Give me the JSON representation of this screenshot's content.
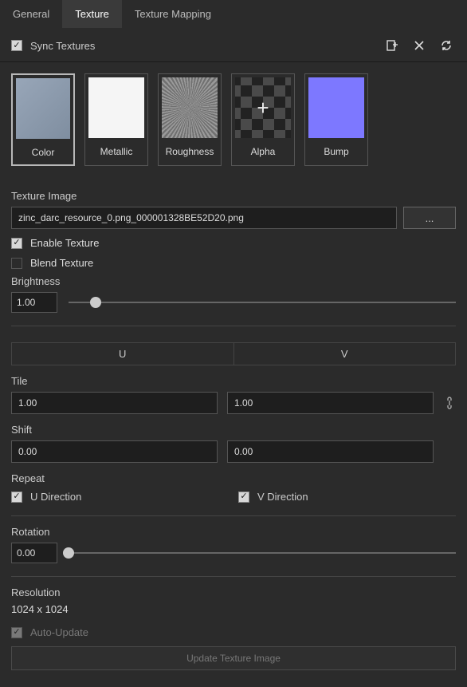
{
  "tabs": {
    "general": "General",
    "texture": "Texture",
    "mapping": "Texture Mapping"
  },
  "sync_label": "Sync Textures",
  "tex_cards": {
    "color": "Color",
    "metallic": "Metallic",
    "roughness": "Roughness",
    "alpha": "Alpha",
    "bump": "Bump"
  },
  "image": {
    "label": "Texture Image",
    "value": "zinc_darc_resource_0.png_000001328BE52D20.png",
    "browse": "..."
  },
  "enable_label": "Enable Texture",
  "blend_label": "Blend Texture",
  "brightness_label": "Brightness",
  "brightness_value": "1.00",
  "uv": {
    "u_head": "U",
    "v_head": "V",
    "tile_label": "Tile",
    "tile_u": "1.00",
    "tile_v": "1.00",
    "shift_label": "Shift",
    "shift_u": "0.00",
    "shift_v": "0.00"
  },
  "repeat": {
    "label": "Repeat",
    "u": "U Direction",
    "v": "V Direction"
  },
  "rotation": {
    "label": "Rotation",
    "value": "0.00"
  },
  "resolution": {
    "label": "Resolution",
    "value": "1024 x 1024"
  },
  "auto_update": "Auto-Update",
  "update_btn": "Update Texture Image"
}
